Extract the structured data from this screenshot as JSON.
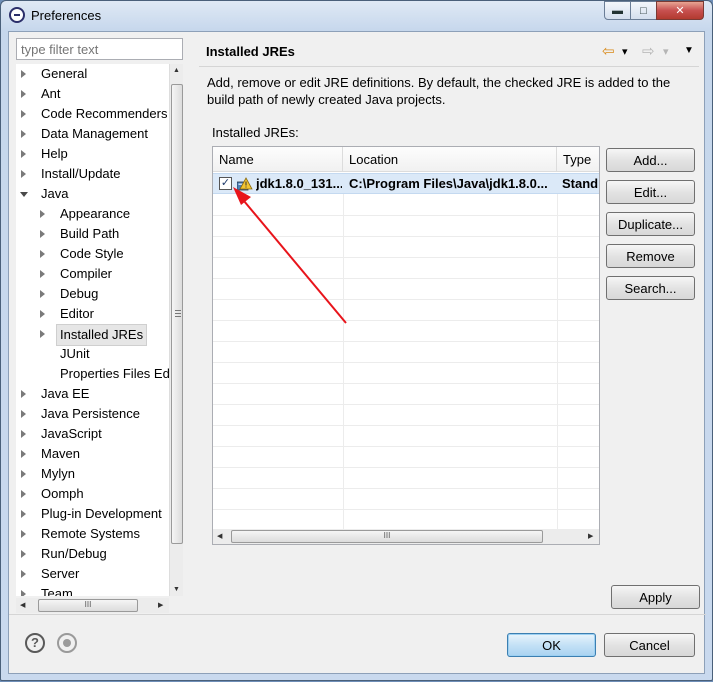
{
  "window": {
    "title": "Preferences",
    "min_glyph": "▬",
    "max_glyph": "□",
    "close_glyph": "✕"
  },
  "filter": {
    "placeholder": "type filter text"
  },
  "tree": {
    "items": [
      {
        "label": "General",
        "expander": "collapsed",
        "level": 0
      },
      {
        "label": "Ant",
        "expander": "collapsed",
        "level": 0
      },
      {
        "label": "Code Recommenders",
        "expander": "collapsed",
        "level": 0
      },
      {
        "label": "Data Management",
        "expander": "collapsed",
        "level": 0
      },
      {
        "label": "Help",
        "expander": "collapsed",
        "level": 0
      },
      {
        "label": "Install/Update",
        "expander": "collapsed",
        "level": 0
      },
      {
        "label": "Java",
        "expander": "expanded",
        "level": 0
      },
      {
        "label": "Appearance",
        "expander": "collapsed",
        "level": 1
      },
      {
        "label": "Build Path",
        "expander": "collapsed",
        "level": 1
      },
      {
        "label": "Code Style",
        "expander": "collapsed",
        "level": 1
      },
      {
        "label": "Compiler",
        "expander": "collapsed",
        "level": 1
      },
      {
        "label": "Debug",
        "expander": "collapsed",
        "level": 1
      },
      {
        "label": "Editor",
        "expander": "collapsed",
        "level": 1
      },
      {
        "label": "Installed JREs",
        "expander": "collapsed",
        "level": 1,
        "selected": true
      },
      {
        "label": "JUnit",
        "expander": "none",
        "level": 1
      },
      {
        "label": "Properties Files Ed",
        "expander": "none",
        "level": 1
      },
      {
        "label": "Java EE",
        "expander": "collapsed",
        "level": 0
      },
      {
        "label": "Java Persistence",
        "expander": "collapsed",
        "level": 0
      },
      {
        "label": "JavaScript",
        "expander": "collapsed",
        "level": 0
      },
      {
        "label": "Maven",
        "expander": "collapsed",
        "level": 0
      },
      {
        "label": "Mylyn",
        "expander": "collapsed",
        "level": 0
      },
      {
        "label": "Oomph",
        "expander": "collapsed",
        "level": 0
      },
      {
        "label": "Plug-in Development",
        "expander": "collapsed",
        "level": 0
      },
      {
        "label": "Remote Systems",
        "expander": "collapsed",
        "level": 0
      },
      {
        "label": "Run/Debug",
        "expander": "collapsed",
        "level": 0
      },
      {
        "label": "Server",
        "expander": "collapsed",
        "level": 0
      },
      {
        "label": "Team",
        "expander": "collapsed",
        "level": 0
      }
    ]
  },
  "page": {
    "title": "Installed JREs",
    "description": "Add, remove or edit JRE definitions. By default, the checked JRE is added to the build path of newly created Java projects.",
    "list_label": "Installed JREs:",
    "columns": [
      "Name",
      "Location",
      "Type"
    ],
    "rows": [
      {
        "checked": true,
        "check_glyph": "✓",
        "name": "jdk1.8.0_131...",
        "location": "C:\\Program Files\\Java\\jdk1.8.0...",
        "type": "Stand"
      }
    ],
    "buttons": {
      "add": "Add...",
      "edit": "Edit...",
      "duplicate": "Duplicate...",
      "remove": "Remove",
      "search": "Search..."
    },
    "apply": "Apply",
    "nav": {
      "back": "⇦",
      "forward": "⇨",
      "dropdown": "▾",
      "menu": "▼"
    }
  },
  "footer": {
    "help_glyph": "?",
    "ok": "OK",
    "cancel": "Cancel"
  },
  "scroll": {
    "grip": "III",
    "up": "▲",
    "down": "▼",
    "left": "◀",
    "right": "▶"
  },
  "colors": {
    "annotation_arrow": "#e8141b",
    "selection": "#dbe9f8",
    "default_button": "#a9d3f1"
  }
}
